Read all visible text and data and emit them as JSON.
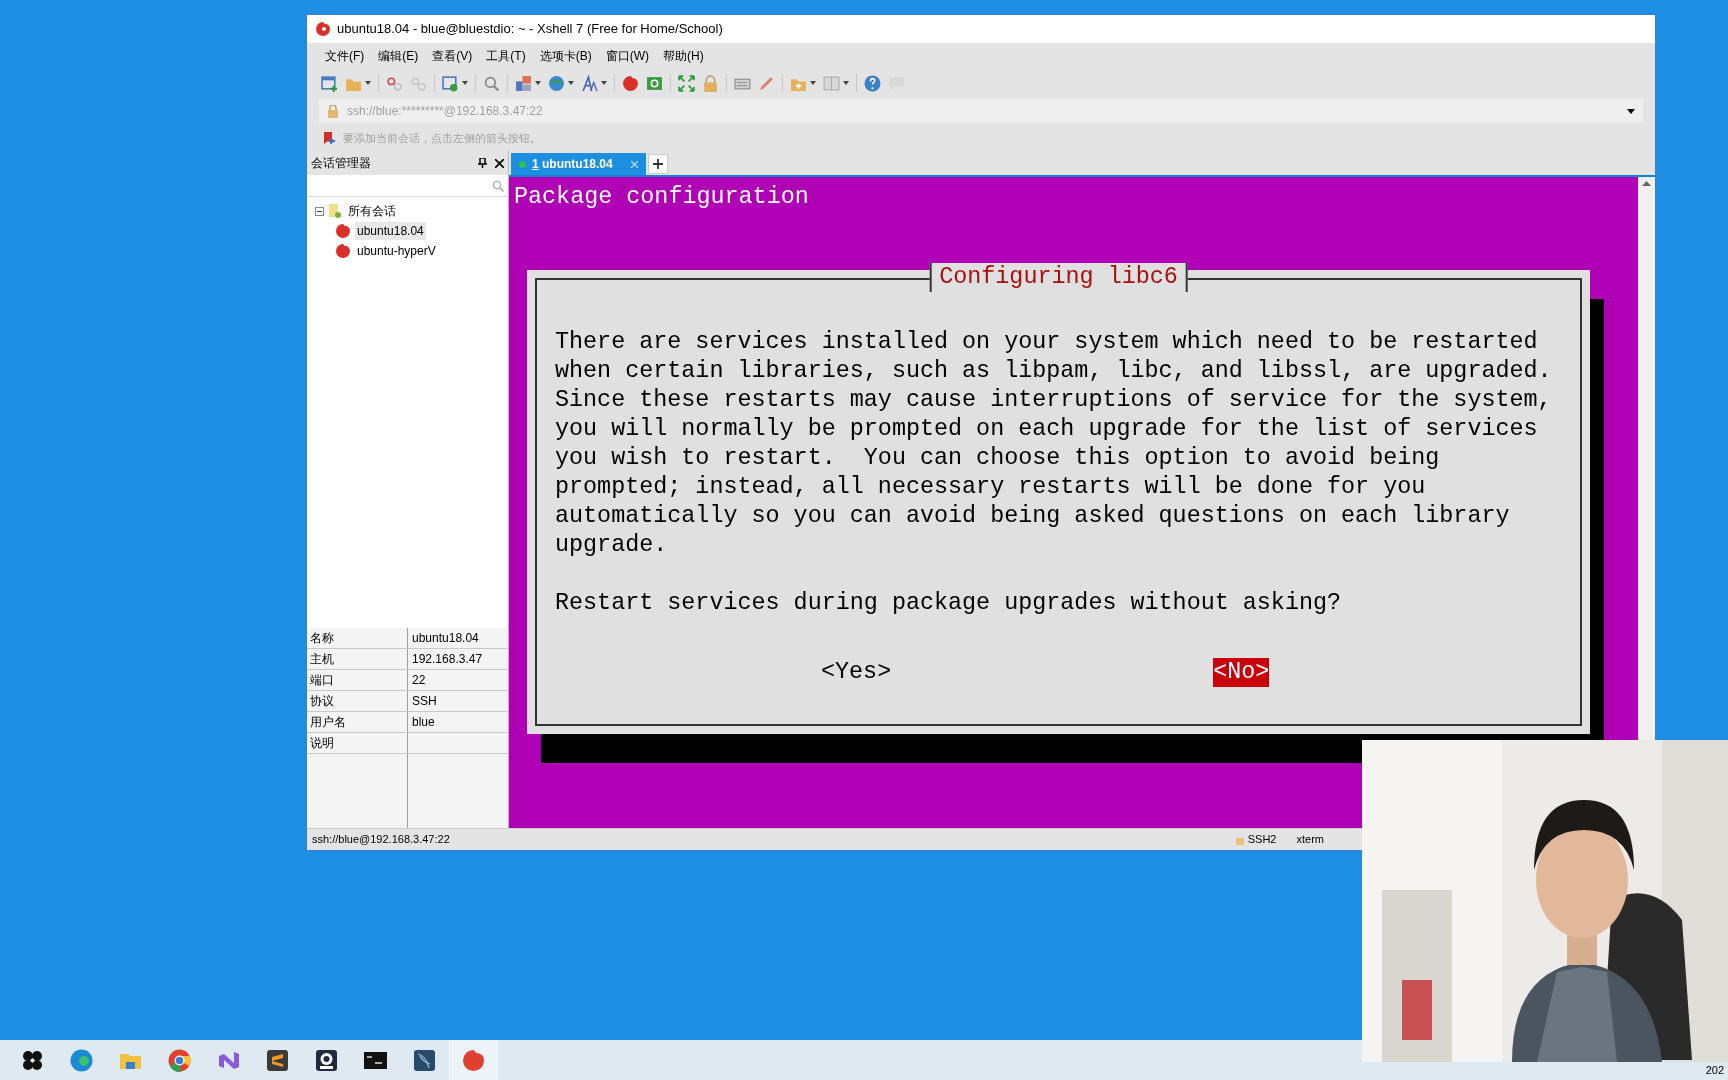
{
  "window": {
    "title": "ubuntu18.04 - blue@bluestdio: ~ - Xshell 7 (Free for Home/School)"
  },
  "menu": [
    "文件(F)",
    "编辑(E)",
    "查看(V)",
    "工具(T)",
    "选项卡(B)",
    "窗口(W)",
    "帮助(H)"
  ],
  "address_bar": {
    "placeholder": "ssh://blue:*********@192.168.3.47:22"
  },
  "hint_bar": {
    "text": "要添加当前会话，点击左侧的箭头按钮。"
  },
  "session_manager": {
    "title": "会话管理器",
    "tree": [
      {
        "label": "所有会话",
        "expanded": true,
        "children": [
          {
            "label": "ubuntu18.04",
            "selected": true
          },
          {
            "label": "ubuntu-hyperV",
            "selected": false
          }
        ]
      }
    ],
    "properties": [
      {
        "name": "名称",
        "value": "ubuntu18.04"
      },
      {
        "name": "主机",
        "value": "192.168.3.47"
      },
      {
        "name": "端口",
        "value": "22"
      },
      {
        "name": "协议",
        "value": "SSH"
      },
      {
        "name": "用户名",
        "value": "blue"
      },
      {
        "name": "说明"
      }
    ]
  },
  "tabs": [
    {
      "number": "1",
      "label": "ubuntu18.04",
      "selected": true
    }
  ],
  "terminal": {
    "heading": "Package configuration",
    "dialog": {
      "title": "Configuring libc6",
      "message": [
        "There are services installed on your system which need to be restarted",
        "when certain libraries, such as libpam, libc, and libssl, are upgraded.",
        "Since these restarts may cause interruptions of service for the system,",
        "you will normally be prompted on each upgrade for the list of services",
        "you wish to restart.  You can choose this option to avoid being",
        "prompted; instead, all necessary restarts will be done for you",
        "automatically so you can avoid being asked questions on each library",
        "upgrade."
      ],
      "question": "Restart services during package upgrades without asking?",
      "buttons": [
        {
          "label": "<Yes>",
          "selected": false
        },
        {
          "label": "<No>",
          "selected": true
        }
      ]
    }
  },
  "status_bar": {
    "address": "ssh://blue@192.168.3.47:22",
    "protocol": "SSH2",
    "terminal_type": "xterm"
  },
  "taskbar": {
    "clock_fragment": "202"
  }
}
